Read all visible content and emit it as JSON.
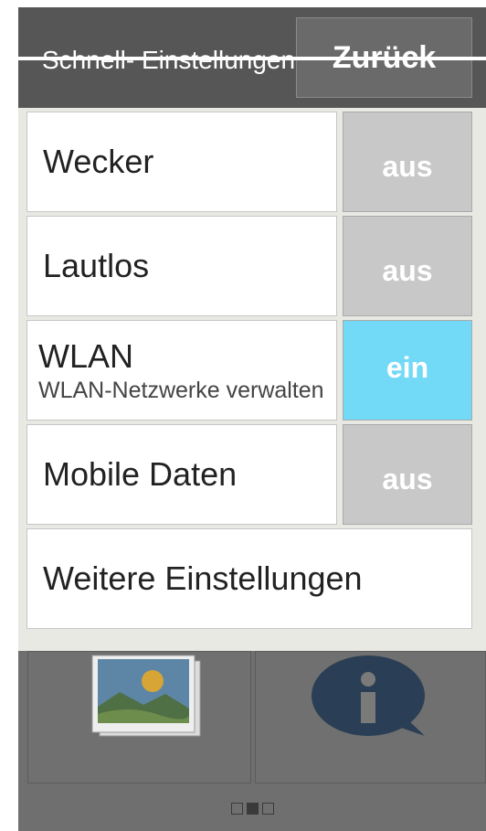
{
  "header": {
    "title": "Schnell- Einstellungen",
    "back_label": "Zurück"
  },
  "settings": [
    {
      "label": "Wecker",
      "subtitle": "",
      "state": "aus"
    },
    {
      "label": "Lautlos",
      "subtitle": "",
      "state": "aus"
    },
    {
      "label": "WLAN",
      "subtitle": "WLAN-Netzwerke verwalten",
      "state": "ein"
    },
    {
      "label": "Mobile Daten",
      "subtitle": "",
      "state": "aus"
    }
  ],
  "more_settings_label": "Weitere Einstellungen",
  "page_indicator": {
    "total": 3,
    "active": 2
  },
  "colors": {
    "toggle_on": "#72d9f7",
    "toggle_off": "#c8c8c8",
    "header_bg": "#565656"
  }
}
